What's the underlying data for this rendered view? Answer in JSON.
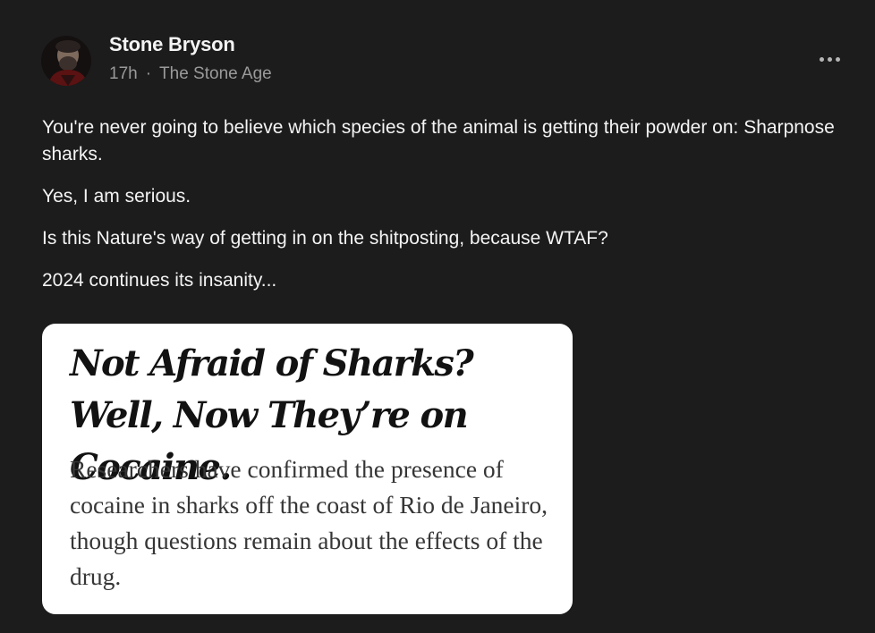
{
  "post": {
    "author": {
      "name": "Stone Bryson",
      "avatar_icon": "profile-photo"
    },
    "timestamp": "17h",
    "separator": "·",
    "publication": "The Stone Age",
    "more_icon": "ellipsis-icon",
    "paragraphs": [
      "You're never going to believe which species of the animal is getting their powder on: Sharpnose sharks.",
      "Yes, I am serious.",
      "Is this Nature's way of getting in on the shitposting, because WTAF?",
      "2024 continues its insanity..."
    ],
    "embed": {
      "headline": "Not Afraid of Sharks? Well, Now They’re on Cocaine.",
      "summary": "Researchers have confirmed the presence of cocaine in sharks off the coast of Rio de Janeiro, though questions remain about the effects of the drug."
    }
  },
  "colors": {
    "background": "#1c1c1c",
    "text_primary": "#f4f4f4",
    "text_secondary": "#9a9a9a",
    "card_background": "#ffffff",
    "card_headline": "#121212",
    "card_summary": "#363636"
  }
}
